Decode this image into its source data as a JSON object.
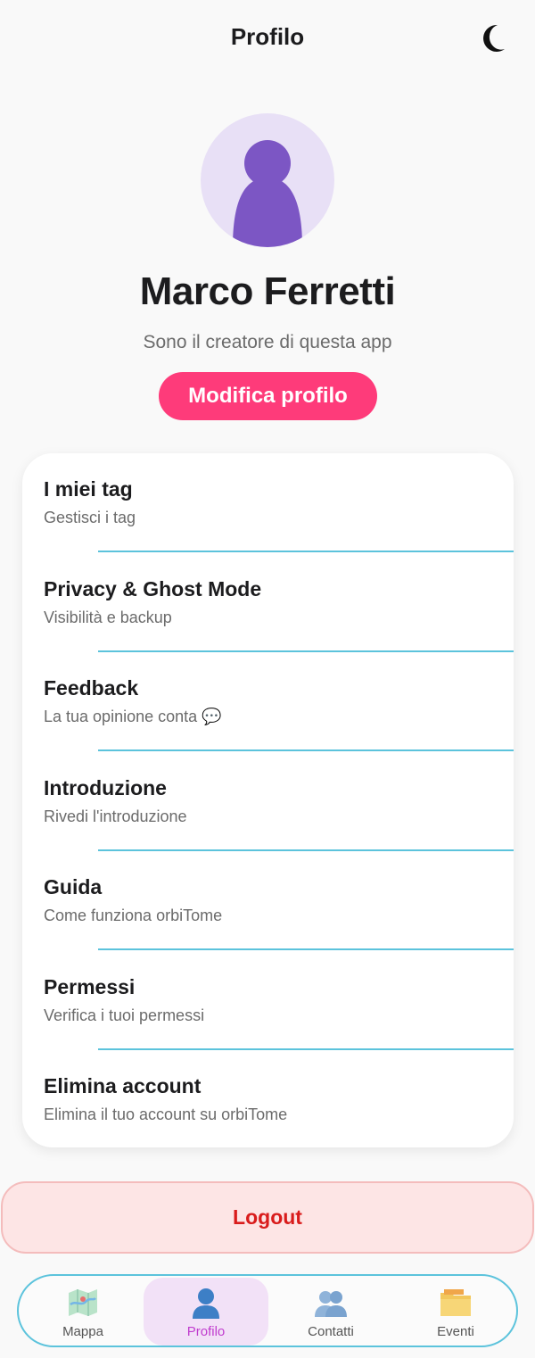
{
  "header": {
    "title": "Profilo",
    "theme_icon": "moon-icon"
  },
  "profile": {
    "avatar_icon": "person-silhouette-icon",
    "name": "Marco Ferretti",
    "bio": "Sono il creatore di questa app",
    "edit_button": "Modifica profilo"
  },
  "menu": {
    "items": [
      {
        "title": "I miei tag",
        "subtitle": "Gestisci i tag"
      },
      {
        "title": "Privacy & Ghost Mode",
        "subtitle": "Visibilità e backup"
      },
      {
        "title": "Feedback",
        "subtitle": "La tua opinione conta 💬"
      },
      {
        "title": "Introduzione",
        "subtitle": "Rivedi l'introduzione"
      },
      {
        "title": "Guida",
        "subtitle": "Come funziona orbiTome"
      },
      {
        "title": "Permessi",
        "subtitle": "Verifica i tuoi permessi"
      },
      {
        "title": "Elimina account",
        "subtitle": "Elimina il tuo account su orbiTome"
      }
    ]
  },
  "logout_label": "Logout",
  "bottom_nav": {
    "active": "Profilo",
    "items": [
      {
        "label": "Mappa",
        "icon": "map-icon"
      },
      {
        "label": "Profilo",
        "icon": "user-icon"
      },
      {
        "label": "Contatti",
        "icon": "contacts-icon"
      },
      {
        "label": "Eventi",
        "icon": "folder-icon"
      }
    ]
  },
  "colors": {
    "accent_pink": "#fe3b7a",
    "avatar_purple": "#7c56c4",
    "divider_cyan": "#5cc3dc",
    "logout_red": "#d91c1c"
  }
}
